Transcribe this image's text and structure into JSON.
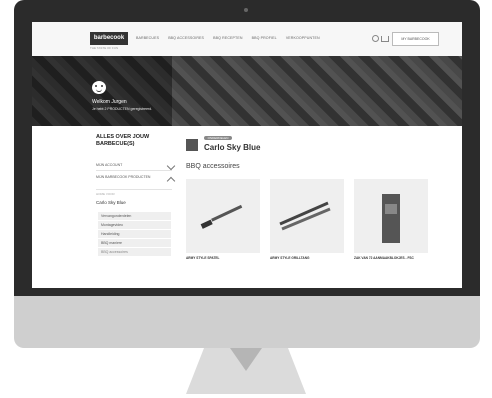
{
  "brand": {
    "logo": "barbecook",
    "tagline": "THE TASTE OF FUN"
  },
  "nav": {
    "items": [
      "BARBECUES",
      "BBQ ACCESSOIRES",
      "BBQ RECEPTEN",
      "BBQ PROFIEL",
      "VERKOOPPUNTEN"
    ],
    "button": "MY BARBECOOK"
  },
  "hero": {
    "welcome": "Welkom Jurgen",
    "subline": "Je hebt 2 PRODUCTEN geregistreerd."
  },
  "sidebar": {
    "title": "ALLES OVER JOUW BARBECUE(S)",
    "account": "MIJN ACCOUNT",
    "products": "MIJN BARBECOOK PRODUCTEN",
    "crumb": "HOME VOOR",
    "current": "Carlo Sky Blue",
    "items": [
      "Vervangonderdelen",
      "Montagevideo",
      "Handleiding",
      "BBQ maniere",
      "BBQ accessoires"
    ]
  },
  "main": {
    "badge": "ONDERDELEN",
    "title": "Carlo Sky Blue",
    "subtitle": "BBQ accessoires",
    "products": [
      {
        "name": "ARMY STYLE SPATEL"
      },
      {
        "name": "ARMY STYLE GRILLTANG"
      },
      {
        "name": "ZAK VAN 72 AANMAAKBLOKJES - FSC"
      }
    ]
  },
  "colors": {
    "monitor": "#2b2b2b",
    "chin": "#cfcfcf",
    "accent": "#333333"
  }
}
